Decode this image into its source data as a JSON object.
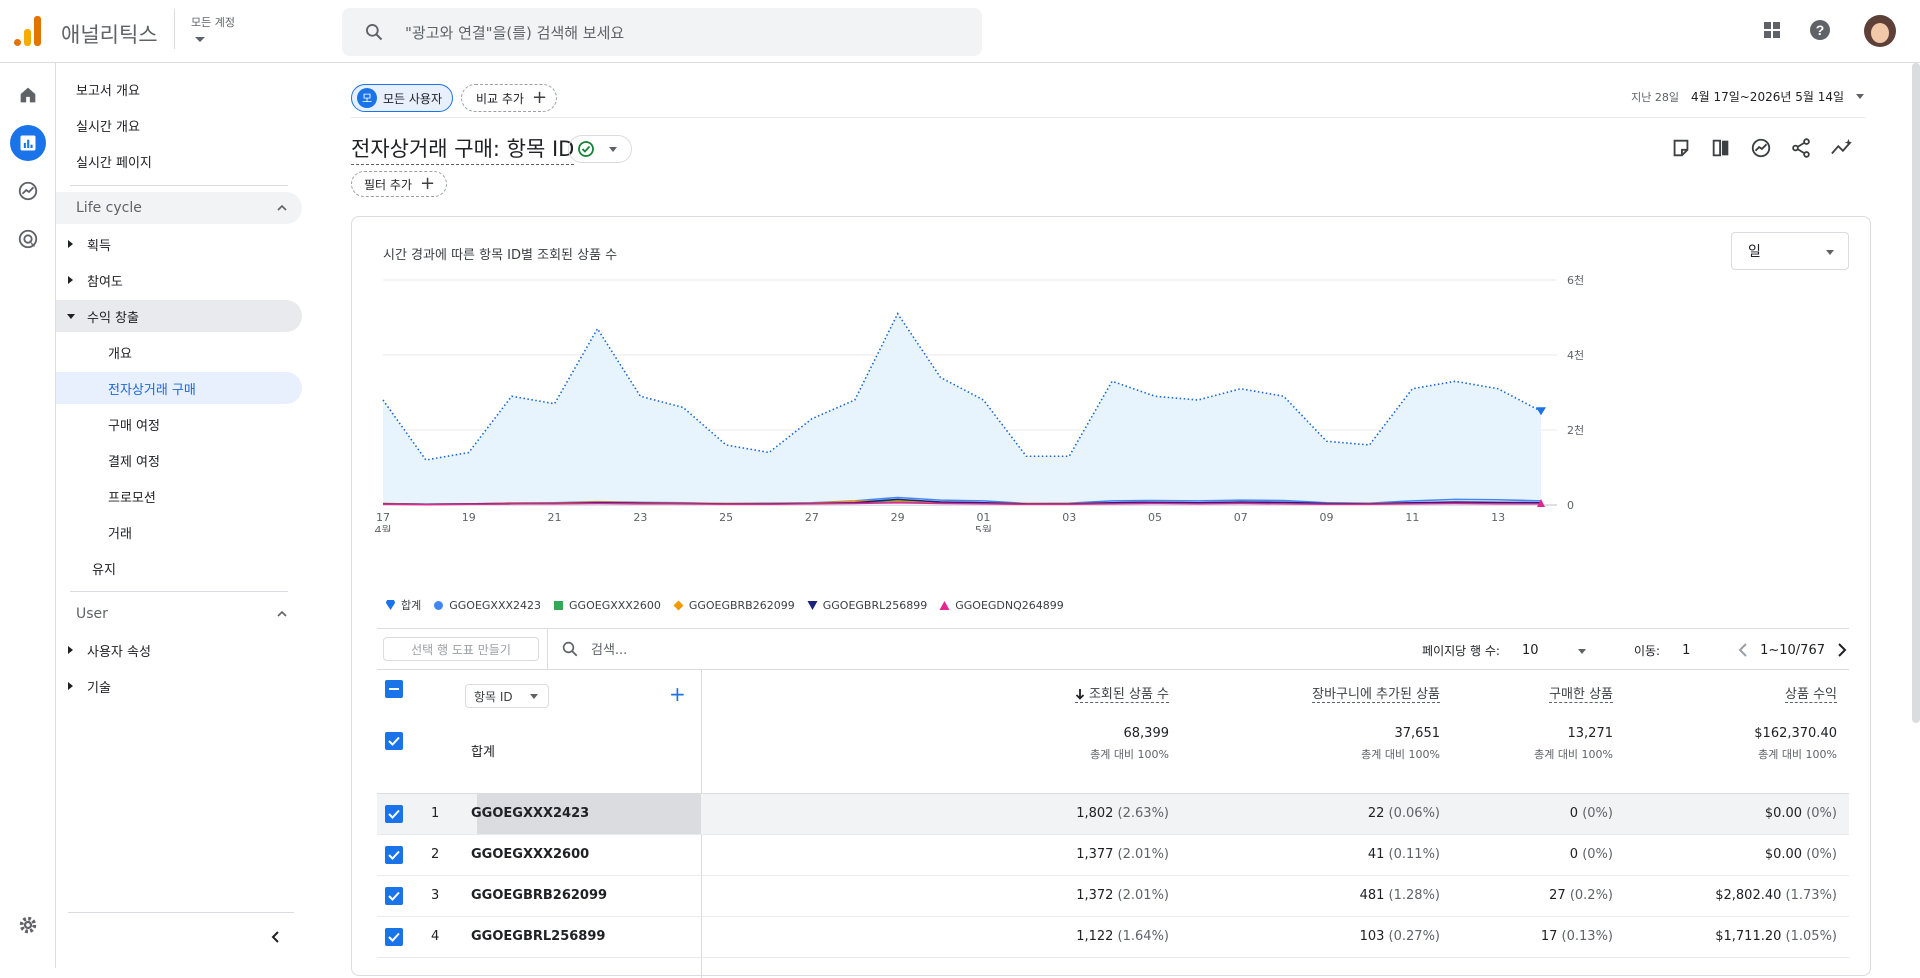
{
  "app": {
    "name": "애널리틱스",
    "account_label": "모든 계정",
    "search_placeholder": "\"광고와 연결\"을(를) 검색해 보세요"
  },
  "nav": {
    "top_items": [
      "보고서 개요",
      "실시간 개요",
      "실시간 페이지"
    ],
    "lifecycle_label": "Life cycle",
    "lifecycle_items": [
      "획득",
      "참여도",
      "수익 창출"
    ],
    "monetization_sub": [
      "개요",
      "전자상거래 구매",
      "구매 여정",
      "결제 여정",
      "프로모션",
      "거래"
    ],
    "retention": "유지",
    "user_label": "User",
    "user_items": [
      "사용자 속성",
      "기술"
    ]
  },
  "filters": {
    "all_users_badge": "모",
    "all_users": "모든 사용자",
    "compare": "비교 추가",
    "add_filter": "필터 추가",
    "date_prefix": "지난 28일",
    "date_range": "4월 17일~2026년 5월 14일"
  },
  "report": {
    "title": "전자상거래 구매: 항목 ID"
  },
  "chart_card": {
    "title": "시간 경과에 따른 항목 ID별 조회된 상품 수",
    "granularity": "일"
  },
  "chart_data": {
    "type": "line",
    "title": "시간 경과에 따른 항목 ID별 조회된 상품 수",
    "x_tick_labels": [
      "17",
      "19",
      "21",
      "23",
      "25",
      "27",
      "29",
      "01",
      "03",
      "05",
      "07",
      "09",
      "11",
      "13"
    ],
    "x_month_labels": [
      "4월",
      "5월"
    ],
    "y_tick_labels": [
      "6천",
      "4천",
      "2천",
      "0"
    ],
    "ylim": [
      0,
      6000
    ],
    "series": [
      {
        "name": "합계",
        "color": "#1a73e8",
        "values": [
          2800,
          1200,
          1400,
          2900,
          2700,
          4700,
          2900,
          2600,
          1600,
          1400,
          2300,
          2800,
          5100,
          3400,
          2800,
          1300,
          1300,
          3300,
          2900,
          2800,
          3100,
          2900,
          1700,
          1600,
          3100,
          3300,
          3100,
          2500
        ]
      },
      {
        "name": "GGOEGXXX2423",
        "color": "#4285f4",
        "values": [
          40,
          20,
          30,
          50,
          60,
          90,
          70,
          60,
          40,
          50,
          60,
          110,
          200,
          130,
          110,
          40,
          50,
          110,
          120,
          110,
          130,
          120,
          60,
          50,
          110,
          150,
          140,
          110
        ]
      },
      {
        "name": "GGOEGXXX2600",
        "color": "#34a853",
        "values": [
          30,
          10,
          20,
          30,
          40,
          50,
          40,
          30,
          30,
          30,
          40,
          60,
          80,
          60,
          50,
          30,
          30,
          50,
          60,
          50,
          60,
          50,
          40,
          30,
          50,
          60,
          50,
          40
        ]
      },
      {
        "name": "GGOEGBRB262099",
        "color": "#f29900",
        "values": [
          40,
          20,
          30,
          50,
          50,
          80,
          60,
          50,
          40,
          40,
          50,
          100,
          120,
          80,
          60,
          40,
          40,
          60,
          70,
          60,
          70,
          60,
          40,
          40,
          60,
          70,
          60,
          50
        ]
      },
      {
        "name": "GGOEGBRL256899",
        "color": "#1a237e",
        "values": [
          30,
          20,
          30,
          40,
          40,
          60,
          50,
          40,
          30,
          30,
          40,
          60,
          150,
          80,
          60,
          30,
          30,
          60,
          70,
          60,
          80,
          70,
          40,
          30,
          60,
          80,
          70,
          60
        ]
      },
      {
        "name": "GGOEGDNQ264899",
        "color": "#e52592",
        "values": [
          20,
          10,
          20,
          30,
          30,
          40,
          30,
          30,
          20,
          20,
          30,
          40,
          60,
          40,
          30,
          20,
          20,
          30,
          40,
          30,
          40,
          30,
          20,
          20,
          30,
          40,
          30,
          30
        ]
      }
    ]
  },
  "table": {
    "plot_rows": "선택 행 도표 만들기",
    "search_placeholder": "검색...",
    "rows_per_page_label": "페이지당 행 수:",
    "rows_per_page": "10",
    "goto_label": "이동:",
    "goto_value": "1",
    "range": "1~10/767",
    "dimension": "항목 ID",
    "headers": [
      "조회된 상품 수",
      "장바구니에 추가된 상품",
      "구매한 상품",
      "상품 수익"
    ],
    "totals_label": "합계",
    "totals": [
      {
        "v": "68,399",
        "p": "총계 대비 100%"
      },
      {
        "v": "37,651",
        "p": "총계 대비 100%"
      },
      {
        "v": "13,271",
        "p": "총계 대비 100%"
      },
      {
        "v": "$162,370.40",
        "p": "총계 대비 100%"
      }
    ],
    "rows": [
      {
        "n": "1",
        "id": "GGOEGXXX2423",
        "c": [
          [
            "1,802",
            "(2.63%)"
          ],
          [
            "22",
            "(0.06%)"
          ],
          [
            "0",
            "(0%)"
          ],
          [
            "$0.00",
            "(0%)"
          ]
        ]
      },
      {
        "n": "2",
        "id": "GGOEGXXX2600",
        "c": [
          [
            "1,377",
            "(2.01%)"
          ],
          [
            "41",
            "(0.11%)"
          ],
          [
            "0",
            "(0%)"
          ],
          [
            "$0.00",
            "(0%)"
          ]
        ]
      },
      {
        "n": "3",
        "id": "GGOEGBRB262099",
        "c": [
          [
            "1,372",
            "(2.01%)"
          ],
          [
            "481",
            "(1.28%)"
          ],
          [
            "27",
            "(0.2%)"
          ],
          [
            "$2,802.40",
            "(1.73%)"
          ]
        ]
      },
      {
        "n": "4",
        "id": "GGOEGBRL256899",
        "c": [
          [
            "1,122",
            "(1.64%)"
          ],
          [
            "103",
            "(0.27%)"
          ],
          [
            "17",
            "(0.13%)"
          ],
          [
            "$1,711.20",
            "(1.05%)"
          ]
        ]
      }
    ]
  }
}
